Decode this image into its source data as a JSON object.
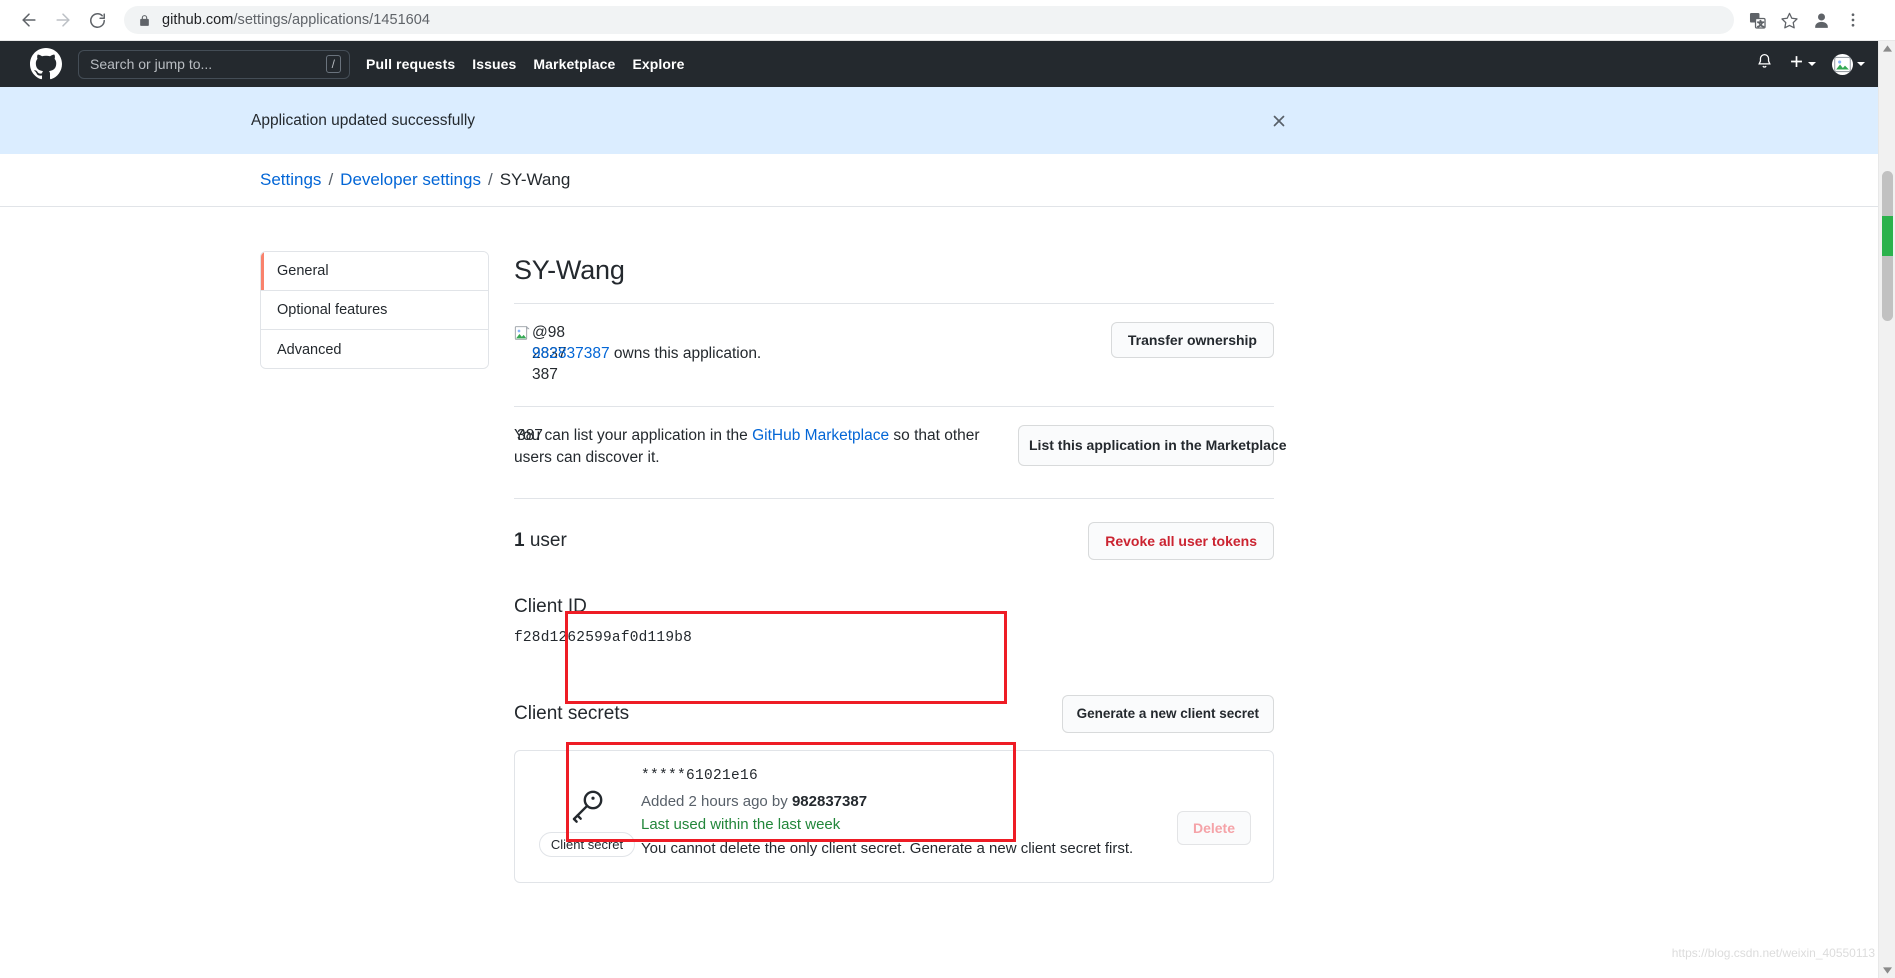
{
  "browser": {
    "url_host": "github.com",
    "url_path": "/settings/applications/1451604",
    "back_icon": "back-arrow-icon",
    "forward_icon": "forward-arrow-icon",
    "reload_icon": "reload-icon",
    "lock_icon": "lock-icon",
    "translate_icon": "translate-icon",
    "bookmark_icon": "star-icon",
    "profile_icon": "profile-avatar-icon",
    "menu_icon": "three-dot-menu-icon"
  },
  "gh_header": {
    "logo": "github-mark-icon",
    "search_placeholder": "Search or jump to...",
    "search_shortcut": "/",
    "nav": [
      {
        "label": "Pull requests"
      },
      {
        "label": "Issues"
      },
      {
        "label": "Marketplace"
      },
      {
        "label": "Explore"
      }
    ],
    "notifications_icon": "bell-icon",
    "create_new_icon": "plus-icon",
    "account_icon": "user-avatar-icon"
  },
  "flash": {
    "message": "Application updated successfully",
    "close_icon": "close-icon",
    "background": "#dbedff"
  },
  "breadcrumb": {
    "settings": "Settings",
    "developer_settings": "Developer settings",
    "current": "SY-Wang",
    "separator": "/"
  },
  "sidebar": {
    "items": [
      {
        "label": "General",
        "active": true
      },
      {
        "label": "Optional features",
        "active": false
      },
      {
        "label": "Advanced",
        "active": false
      }
    ],
    "active_accent": "#f9826c"
  },
  "main": {
    "app_name": "SY-Wang",
    "owner": {
      "avatar_alt": "@982837387",
      "avatar_alt_wrapped": [
        "@",
        "982",
        "837",
        "387"
      ],
      "owner_link": "982837387",
      "owner_suffix": "owns this application.",
      "transfer_button": "Transfer ownership"
    },
    "marketplace": {
      "text_before": "You can list your application in the ",
      "link": "GitHub Marketplace",
      "text_after": " so that other users can discover it.",
      "overflow_fragment": "387",
      "button": "List this application in the Marketplace"
    },
    "users": {
      "count": "1",
      "label": " user",
      "revoke_button": "Revoke all user tokens"
    },
    "client_id": {
      "heading": "Client ID",
      "value": "f28d1262599af0d119b8"
    },
    "client_secrets": {
      "heading": "Client secrets",
      "generate_button": "Generate a new client secret",
      "secret": {
        "icon": "key-icon",
        "tag": "Client secret",
        "masked_value": "*****61021e16",
        "added_prefix": "Added 2 hours ago by ",
        "added_by": "982837387",
        "last_used": "Last used within the last week",
        "note": "You cannot delete the only client secret. Generate a new client secret first.",
        "delete_button": "Delete"
      }
    }
  },
  "annotations": {
    "color": "#ee1c25",
    "boxes": [
      "client-id-highlight",
      "client-secrets-highlight"
    ]
  },
  "watermark": "https://blog.csdn.net/weixin_40550113"
}
